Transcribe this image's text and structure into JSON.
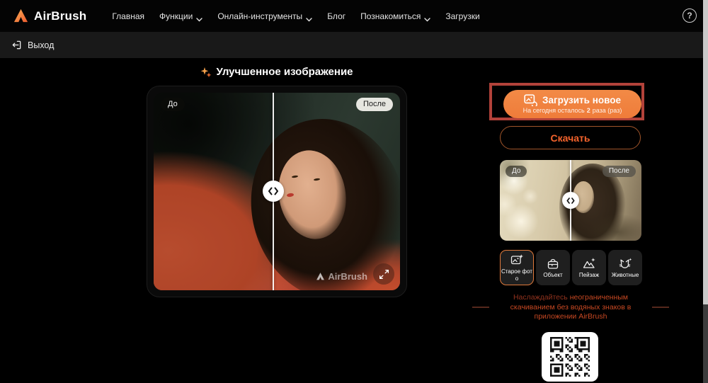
{
  "colors": {
    "accent_orange": "#ef7c3a",
    "highlight_red": "#b2423a",
    "download_orange": "#f4632c",
    "promo_orange": "#c74822",
    "promo_dark_red": "#93331e",
    "background": "#000000",
    "subnav_gray": "#191919"
  },
  "nav": {
    "brand": "AirBrush",
    "help": "?",
    "items": [
      {
        "label": "Главная",
        "dropdown": false
      },
      {
        "label": "Функции",
        "dropdown": true
      },
      {
        "label": "Онлайн-инструменты",
        "dropdown": true
      },
      {
        "label": "Блог",
        "dropdown": false
      },
      {
        "label": "Познакомиться",
        "dropdown": true
      },
      {
        "label": "Загрузки",
        "dropdown": false
      }
    ]
  },
  "subnav": {
    "logout_label": "Выход"
  },
  "main": {
    "title": "Улучшенное изображение",
    "title_icon": "sparkles-icon",
    "compare": {
      "before_label": "До",
      "after_label": "После",
      "watermark": "AirBrush"
    }
  },
  "panel": {
    "upload": {
      "label": "Загрузить новое",
      "sub_prefix": "На сегодня осталось",
      "sub_count": "2",
      "sub_suffix": "раза (раз)"
    },
    "download_label": "Скачать",
    "preview": {
      "before_label": "До",
      "after_label": "После"
    },
    "categories": [
      {
        "label": "Старое фото",
        "selected": true,
        "icon": "old-photo-icon"
      },
      {
        "label": "Объект",
        "selected": false,
        "icon": "object-icon"
      },
      {
        "label": "Пейзаж",
        "selected": false,
        "icon": "landscape-icon"
      },
      {
        "label": "Животные",
        "selected": false,
        "icon": "animals-icon"
      }
    ],
    "promo": {
      "word1": "Наслаждайтесь",
      "line1_rest": "неограниченным",
      "line2": "скачиванием без водяных знаков в",
      "line3": "приложении AirBrush"
    }
  }
}
